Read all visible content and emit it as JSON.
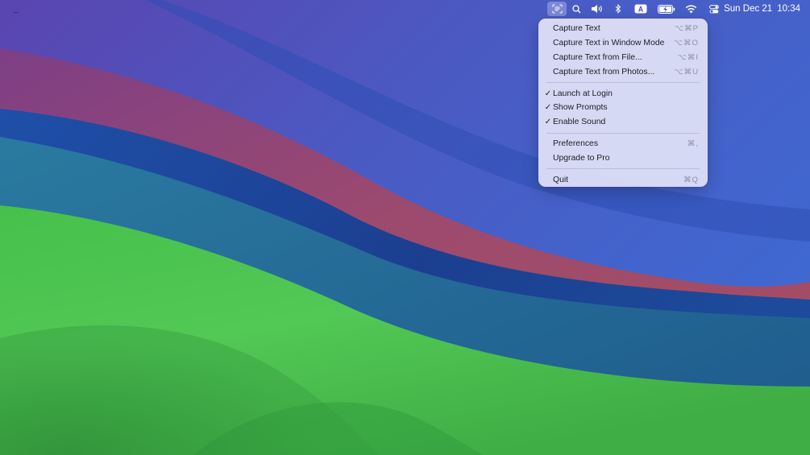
{
  "menubar": {
    "icons": [
      {
        "name": "text-capture-icon",
        "active": true
      },
      {
        "name": "spotlight-search-icon"
      },
      {
        "name": "volume-icon"
      },
      {
        "name": "bluetooth-icon"
      },
      {
        "name": "input-source-icon",
        "glyph": "A"
      },
      {
        "name": "battery-charging-icon"
      },
      {
        "name": "wifi-icon"
      },
      {
        "name": "control-center-icon"
      }
    ],
    "clock": {
      "date": "Sun Dec 21",
      "time": "10:34"
    }
  },
  "menu": {
    "groups": [
      [
        {
          "label": "Capture Text",
          "shortcut": "⌥⌘P"
        },
        {
          "label": "Capture Text in Window Mode",
          "shortcut": "⌥⌘O"
        },
        {
          "label": "Capture Text from File...",
          "shortcut": "⌥⌘I"
        },
        {
          "label": "Capture Text from Photos...",
          "shortcut": "⌥⌘U"
        }
      ],
      [
        {
          "label": "Launch at Login",
          "checked": true
        },
        {
          "label": "Show Prompts",
          "checked": true
        },
        {
          "label": "Enable Sound",
          "checked": true
        }
      ],
      [
        {
          "label": "Preferences",
          "shortcut": "⌘,"
        },
        {
          "label": "Upgrade to Pro"
        }
      ],
      [
        {
          "label": "Quit",
          "shortcut": "⌘Q"
        }
      ]
    ],
    "check_glyph": "✓"
  },
  "colors": {
    "menu_bg": "#e1e2f8",
    "wallpaper_green": "#4fc24f",
    "wallpaper_blue": "#2a4fb0",
    "wallpaper_purple": "#5a4aa8",
    "wallpaper_red": "#9a4a72"
  }
}
